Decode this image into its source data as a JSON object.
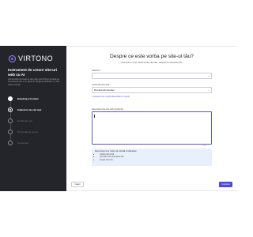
{
  "sidebar": {
    "logo_text": "VIRTONO",
    "headline": "Instrument de creare site-uri web cu AI",
    "subtext": "Instrumentul de creare a site-urilor web Virtono vă ajută să vă construiți site-ul cu ajutorul inteligenței artificiale, în doar câteva minute.",
    "steps": [
      {
        "label": "Branding și Contact",
        "state": "done"
      },
      {
        "label": "Subiectul site-ului web",
        "state": "active"
      },
      {
        "label": "Detalii site web",
        "state": "pending"
      },
      {
        "label": "Previzualizare layout",
        "state": "pending"
      },
      {
        "label": "Înregistrare",
        "state": "pending"
      }
    ]
  },
  "main": {
    "title": "Despre ce este vorba pe site-ul tău?",
    "subtitle": "Creează un prim draft al site-ului tău, adaptat la subiectul tău.",
    "field1_label": "Industrie *",
    "field1_value": "",
    "field2_label": "Limba site-ului web *",
    "field2_value": "Română (Romanian)",
    "link_text": "+ Adaugă încă o limbă (disponibilă în curând)",
    "textarea_label": "Descrierea site-ului web (Opțional)",
    "textarea_value": "",
    "counter": "0/500",
    "tips_title": "Descrierea ta ar trebui să includă următoarele:",
    "tips": [
      "publicul tău țintă",
      "serviciile sau produsele tale",
      "scopul site-ului"
    ]
  },
  "footer": {
    "back_label": "Înapoi",
    "next_label": "Continuă"
  },
  "colors": {
    "sidebar_bg": "#24252a",
    "accent": "#4f46e5",
    "tips_bg": "#e8f0fb"
  }
}
